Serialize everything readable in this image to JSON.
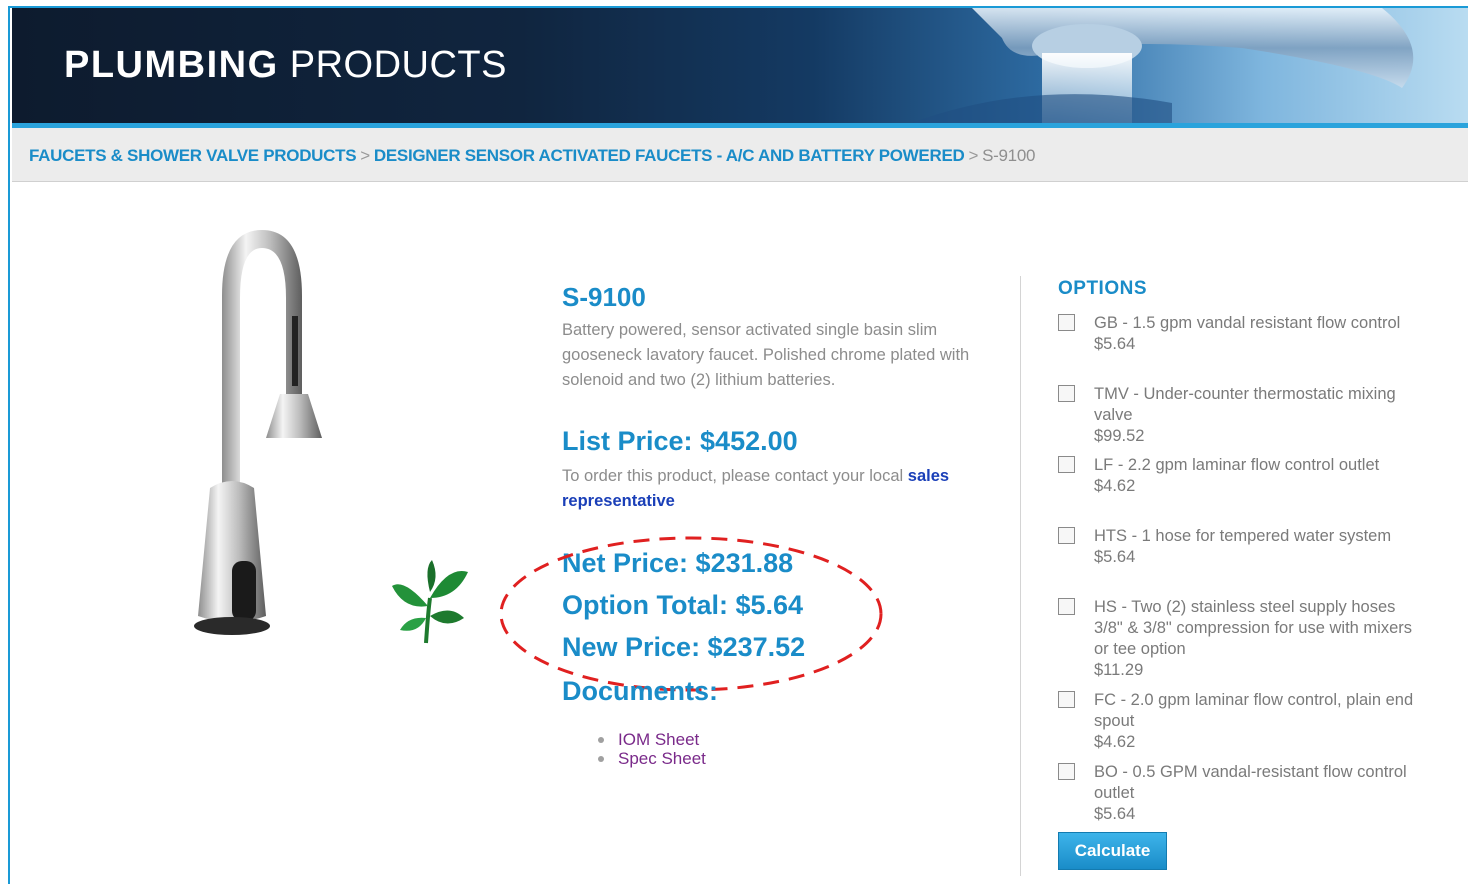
{
  "header": {
    "brand_bold": "PLUMBING",
    "brand_rest": "PRODUCTS"
  },
  "breadcrumb": {
    "items": [
      "FAUCETS & SHOWER VALVE PRODUCTS",
      "DESIGNER SENSOR ACTIVATED FAUCETS - A/C AND BATTERY POWERED"
    ],
    "separator": ">",
    "current": "S-9100"
  },
  "product": {
    "model": "S-9100",
    "description": "Battery powered, sensor activated single basin slim gooseneck lavatory faucet. Polished chrome plated with solenoid and two (2) lithium batteries.",
    "list_price": "List Price: $452.00",
    "order_note": "To order this product, please contact your local",
    "order_link": "sales representative",
    "net_price": "Net Price: $231.88",
    "option_total": "Option Total: $5.64",
    "new_price": "New Price: $237.52"
  },
  "documents": {
    "title": "Documents:",
    "items": [
      "IOM Sheet",
      "Spec Sheet"
    ]
  },
  "options": {
    "title": "OPTIONS",
    "items": [
      {
        "label": "GB - 1.5 gpm vandal resistant flow control",
        "price": "$5.64",
        "checked": false
      },
      {
        "label": "TMV - Under-counter thermostatic mixing valve",
        "price": "$99.52",
        "checked": false
      },
      {
        "label": "LF - 2.2 gpm laminar flow control outlet",
        "price": "$4.62",
        "checked": false
      },
      {
        "label": "HTS - 1 hose for tempered water system",
        "price": "$5.64",
        "checked": false
      },
      {
        "label": "HS - Two (2) stainless steel supply hoses 3/8\" & 3/8\" compression for use with mixers or tee option",
        "price": "$11.29",
        "checked": false
      },
      {
        "label": "FC - 2.0 gpm laminar flow control, plain end spout",
        "price": "$4.62",
        "checked": false
      },
      {
        "label": "BO - 0.5 GPM vandal-resistant flow control outlet",
        "price": "$5.64",
        "checked": false
      }
    ],
    "calculate_label": "Calculate"
  },
  "colors": {
    "accent": "#1a8cc8",
    "banner": "#0d1b2e",
    "highlight": "#e02020"
  }
}
